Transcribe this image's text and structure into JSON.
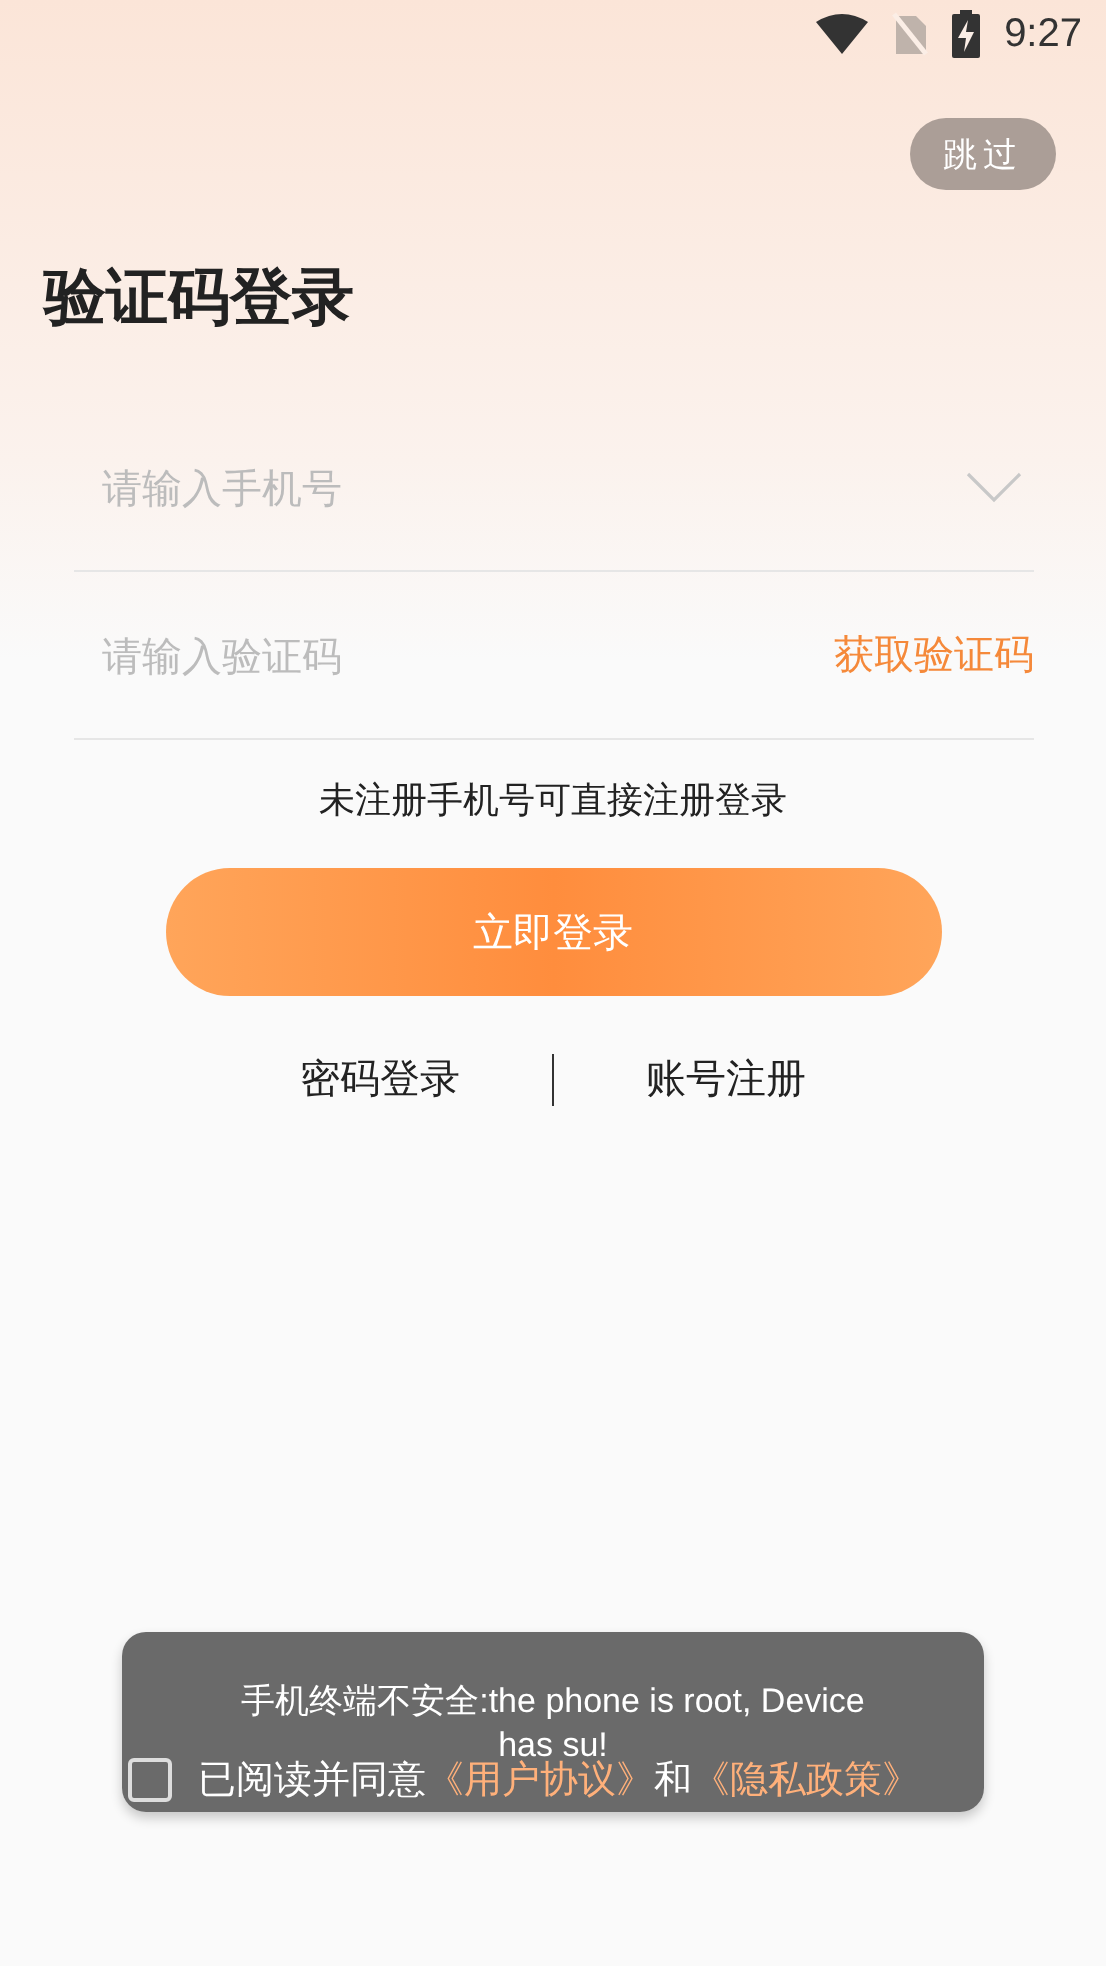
{
  "status_bar": {
    "time": "9:27"
  },
  "skip_button": "跳过",
  "title": "验证码登录",
  "phone_field": {
    "placeholder": "请输入手机号"
  },
  "code_field": {
    "placeholder": "请输入验证码",
    "action": "获取验证码"
  },
  "note": "未注册手机号可直接注册登录",
  "login_button": "立即登录",
  "links": [
    {
      "label": "密码登录"
    },
    {
      "label": "账号注册"
    }
  ],
  "agreement": {
    "checked": false,
    "text_before": "已阅读并同意",
    "terms_link": "《用户协议》",
    "joiner": "和",
    "privacy_link": "《隐私政策》"
  },
  "toast": "手机终端不安全:the phone is root, Device has su!"
}
